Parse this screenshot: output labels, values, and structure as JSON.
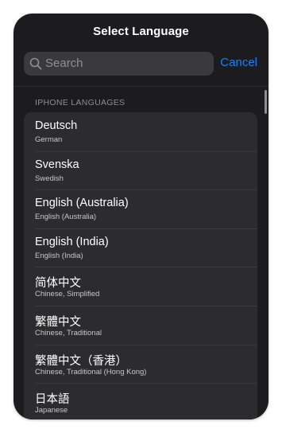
{
  "header": {
    "title": "Select Language"
  },
  "search": {
    "placeholder": "Search",
    "cancel_label": "Cancel"
  },
  "section": {
    "title": "IPHONE LANGUAGES"
  },
  "languages": [
    {
      "name": "Deutsch",
      "english": "German"
    },
    {
      "name": "Svenska",
      "english": "Swedish"
    },
    {
      "name": "English (Australia)",
      "english": "English (Australia)"
    },
    {
      "name": "English (India)",
      "english": "English (India)"
    },
    {
      "name": "简体中文",
      "english": "Chinese, Simplified"
    },
    {
      "name": "繁體中文",
      "english": "Chinese, Traditional"
    },
    {
      "name": "繁體中文（香港）",
      "english": "Chinese, Traditional (Hong Kong)"
    },
    {
      "name": "日本語",
      "english": "Japanese"
    }
  ],
  "colors": {
    "accent": "#0a84ff",
    "background": "#1c1c1e",
    "row_background": "#2c2c2e"
  }
}
